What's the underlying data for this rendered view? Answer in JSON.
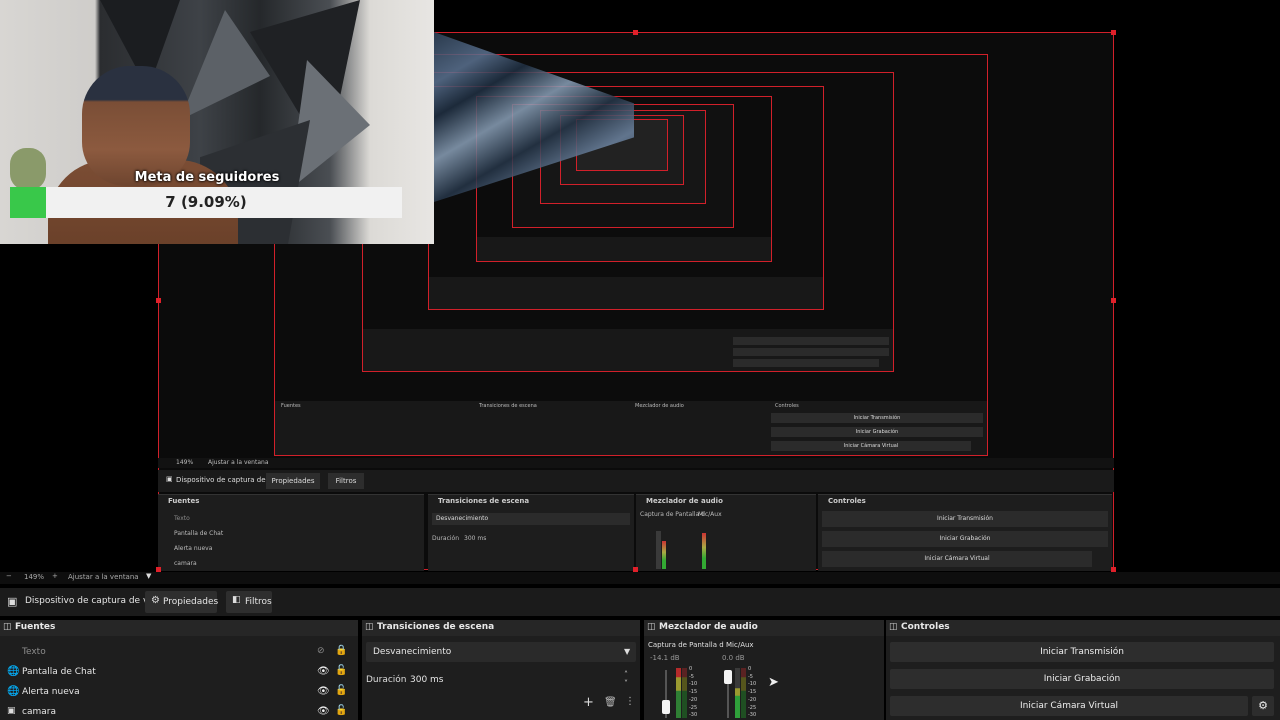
{
  "colors": {
    "accent_red": "#d1202a",
    "goal_fill": "#39c84a",
    "dock_bg": "#1e1e1e",
    "header_bg": "#262626"
  },
  "webcam": {
    "goal_title": "Meta de seguidores",
    "goal_value": "7 (9.09%)",
    "goal_progress": 0.0909
  },
  "preview": {
    "zoom_small": "149%",
    "fit_small": "Ajustar a la ventana",
    "nested_zoom": "149%",
    "nested_fit": "Ajustar a la ventana"
  },
  "zoom_bar": {
    "zoom": "149%",
    "fit": "Ajustar a la ventana"
  },
  "context_bar": {
    "camera_icon": "camera-icon",
    "source_label": "Dispositivo de captura de víd",
    "properties_label": "Propiedades",
    "filters_label": "Filtros"
  },
  "sources": {
    "title": "Fuentes",
    "items": [
      {
        "label": "Texto",
        "icon": "text-icon",
        "visible": false
      },
      {
        "label": "Pantalla de Chat",
        "icon": "browser-icon",
        "visible": true
      },
      {
        "label": "Alerta nueva",
        "icon": "browser-icon",
        "visible": true
      },
      {
        "label": "camara",
        "icon": "camera-icon",
        "visible": true
      }
    ]
  },
  "transitions": {
    "title": "Transiciones de escena",
    "selected": "Desvanecimiento",
    "duration_label": "Duración",
    "duration_value": "300 ms"
  },
  "mixer": {
    "title": "Mezclador de audio",
    "channels": [
      {
        "name": "Captura de Pantalla d",
        "level": "-14.1 dB"
      },
      {
        "name": "Mic/Aux",
        "level": "0.0 dB"
      }
    ],
    "scale": [
      "0",
      "-5",
      "-10",
      "-15",
      "-20",
      "-25",
      "-30"
    ]
  },
  "controls": {
    "title": "Controles",
    "start_stream": "Iniciar Transmisión",
    "start_record": "Iniciar Grabación",
    "start_virtualcam": "Iniciar Cámara Virtual"
  }
}
